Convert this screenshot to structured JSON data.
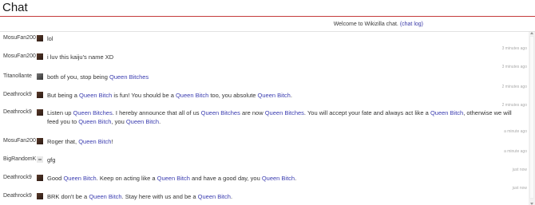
{
  "header": {
    "title": "Chat"
  },
  "welcome": {
    "text": "Welcome to Wikizilla chat.",
    "link": "(chat log)"
  },
  "messages": [
    {
      "user": "MosuFan200",
      "avatar": "dark",
      "parts": [
        {
          "t": "lol"
        }
      ],
      "time": "3 minutes ago"
    },
    {
      "user": "MosuFan200",
      "avatar": "dark",
      "parts": [
        {
          "t": "i luv this kaiju's name XD"
        }
      ],
      "time": "3 minutes ago"
    },
    {
      "user": "Titanollante",
      "avatar": "gray",
      "parts": [
        {
          "t": "both of you, stop being "
        },
        {
          "t": "Queen Bitches",
          "h": 1
        }
      ],
      "time": "2 minutes ago"
    },
    {
      "user": "Deathrock9",
      "avatar": "dark",
      "parts": [
        {
          "t": "But being a "
        },
        {
          "t": "Queen Bitch",
          "h": 1
        },
        {
          "t": " is fun! You should be a "
        },
        {
          "t": "Queen Bitch",
          "h": 1
        },
        {
          "t": " too, you absolute "
        },
        {
          "t": "Queen Bitch",
          "h": 1
        },
        {
          "t": "."
        }
      ],
      "time": "2 minutes ago"
    },
    {
      "user": "Deathrock9",
      "avatar": "dark",
      "parts": [
        {
          "t": "Listen up "
        },
        {
          "t": "Queen Bitches",
          "h": 1
        },
        {
          "t": ". I hereby announce that all of us "
        },
        {
          "t": "Queen Bitches",
          "h": 1
        },
        {
          "t": " are now "
        },
        {
          "t": "Queen Bitches",
          "h": 1
        },
        {
          "t": ". You will accept your fate and always act like a "
        },
        {
          "t": "Queen Bitch",
          "h": 1
        },
        {
          "t": ", otherwise we will feed you to "
        },
        {
          "t": "Queen Bitch",
          "h": 1
        },
        {
          "t": ", you "
        },
        {
          "t": "Queen Bitch",
          "h": 1
        },
        {
          "t": "."
        }
      ],
      "time": "a minute ago"
    },
    {
      "user": "MosuFan200",
      "avatar": "dark",
      "parts": [
        {
          "t": "Roger that, "
        },
        {
          "t": "Queen Bitch",
          "h": 1
        },
        {
          "t": "!"
        }
      ],
      "time": "a minute ago"
    },
    {
      "user": "BigRandomK",
      "avatar": "light",
      "parts": [
        {
          "t": "gfg"
        }
      ],
      "time": "just now"
    },
    {
      "user": "Deathrock9",
      "avatar": "dark",
      "parts": [
        {
          "t": "Good "
        },
        {
          "t": "Queen Bitch",
          "h": 1
        },
        {
          "t": ". Keep on acting like a "
        },
        {
          "t": "Queen Bitch",
          "h": 1
        },
        {
          "t": " and have a good day, you "
        },
        {
          "t": "Queen Bitch",
          "h": 1
        },
        {
          "t": "."
        }
      ],
      "time": "just now"
    },
    {
      "user": "Deathrock9",
      "avatar": "dark",
      "parts": [
        {
          "t": "BRK don't be a "
        },
        {
          "t": "Queen Bitch",
          "h": 1
        },
        {
          "t": ". Stay here with us and be a "
        },
        {
          "t": "Queen Bitch",
          "h": 1
        },
        {
          "t": "."
        }
      ],
      "time": ""
    }
  ]
}
